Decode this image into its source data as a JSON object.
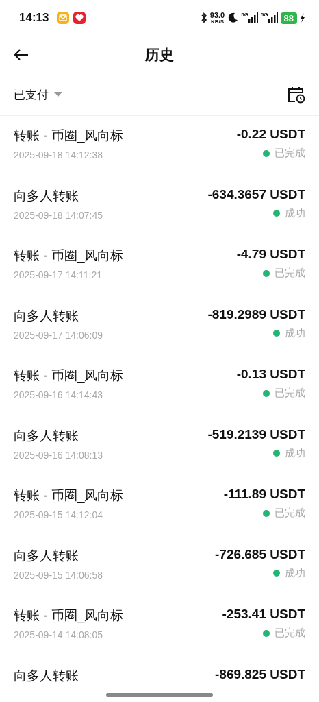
{
  "status_bar": {
    "time": "14:13",
    "speed": "93.0",
    "speed_unit": "KB/S",
    "signal_1": "5G",
    "signal_2": "5G",
    "battery": "88"
  },
  "header": {
    "title": "历史"
  },
  "filter": {
    "label": "已支付"
  },
  "transactions": [
    {
      "title": "转账 - 币圈_风向标",
      "date": "2025-09-18 14:12:38",
      "amount": "-0.22 USDT",
      "status": "已完成"
    },
    {
      "title": "向多人转账",
      "date": "2025-09-18 14:07:45",
      "amount": "-634.3657 USDT",
      "status": "成功"
    },
    {
      "title": "转账 - 币圈_风向标",
      "date": "2025-09-17 14:11:21",
      "amount": "-4.79 USDT",
      "status": "已完成"
    },
    {
      "title": "向多人转账",
      "date": "2025-09-17 14:06:09",
      "amount": "-819.2989 USDT",
      "status": "成功"
    },
    {
      "title": "转账 - 币圈_风向标",
      "date": "2025-09-16 14:14:43",
      "amount": "-0.13 USDT",
      "status": "已完成"
    },
    {
      "title": "向多人转账",
      "date": "2025-09-16 14:08:13",
      "amount": "-519.2139 USDT",
      "status": "成功"
    },
    {
      "title": "转账 - 币圈_风向标",
      "date": "2025-09-15 14:12:04",
      "amount": "-111.89 USDT",
      "status": "已完成"
    },
    {
      "title": "向多人转账",
      "date": "2025-09-15 14:06:58",
      "amount": "-726.685 USDT",
      "status": "成功"
    },
    {
      "title": "转账 - 币圈_风向标",
      "date": "2025-09-14 14:08:05",
      "amount": "-253.41 USDT",
      "status": "已完成"
    },
    {
      "title": "向多人转账",
      "amount": "-869.825 USDT"
    }
  ]
}
